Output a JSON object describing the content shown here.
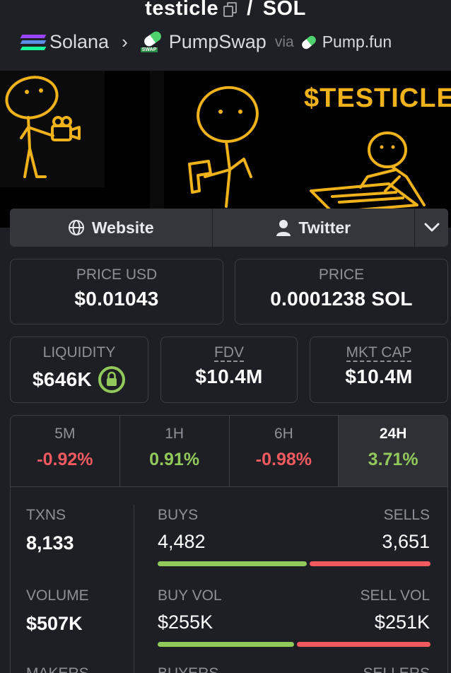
{
  "header": {
    "token": "testicle",
    "slash": "/",
    "quote": "SOL",
    "chain": "Solana",
    "dex": "PumpSwap",
    "via": "via",
    "launchpad": "Pump.fun"
  },
  "banner": {
    "ticker": "$TESTICLE"
  },
  "links": {
    "website": "Website",
    "twitter": "Twitter"
  },
  "prices": {
    "price_usd_label": "PRICE USD",
    "price_usd": "$0.01043",
    "price_label": "PRICE",
    "price_sol": "0.0001238 SOL"
  },
  "metrics": {
    "liquidity_label": "LIQUIDITY",
    "liquidity": "$646K",
    "fdv_label": "FDV",
    "fdv": "$10.4M",
    "mktcap_label": "MKT CAP",
    "mktcap": "$10.4M"
  },
  "periods": [
    {
      "label": "5M",
      "value": "-0.92%",
      "sign": "neg"
    },
    {
      "label": "1H",
      "value": "0.91%",
      "sign": "pos"
    },
    {
      "label": "6H",
      "value": "-0.98%",
      "sign": "neg"
    },
    {
      "label": "24H",
      "value": "3.71%",
      "sign": "pos",
      "active": true
    }
  ],
  "stats": {
    "txns_label": "TXNS",
    "txns": "8,133",
    "buys_label": "BUYS",
    "buys": "4,482",
    "sells_label": "SELLS",
    "sells": "3,651",
    "volume_label": "VOLUME",
    "volume": "$507K",
    "buyvol_label": "BUY VOL",
    "buyvol": "$255K",
    "sellvol_label": "SELL VOL",
    "sellvol": "$251K",
    "makers_label": "MAKERS",
    "buyers_label": "BUYERS",
    "sellers_label": "SELLERS",
    "buy_share_txns": 0.551,
    "buy_share_vol": 0.504
  },
  "colors": {
    "positive": "#92c95b",
    "negative": "#f05a5f",
    "banner_accent": "#f0b21a"
  }
}
